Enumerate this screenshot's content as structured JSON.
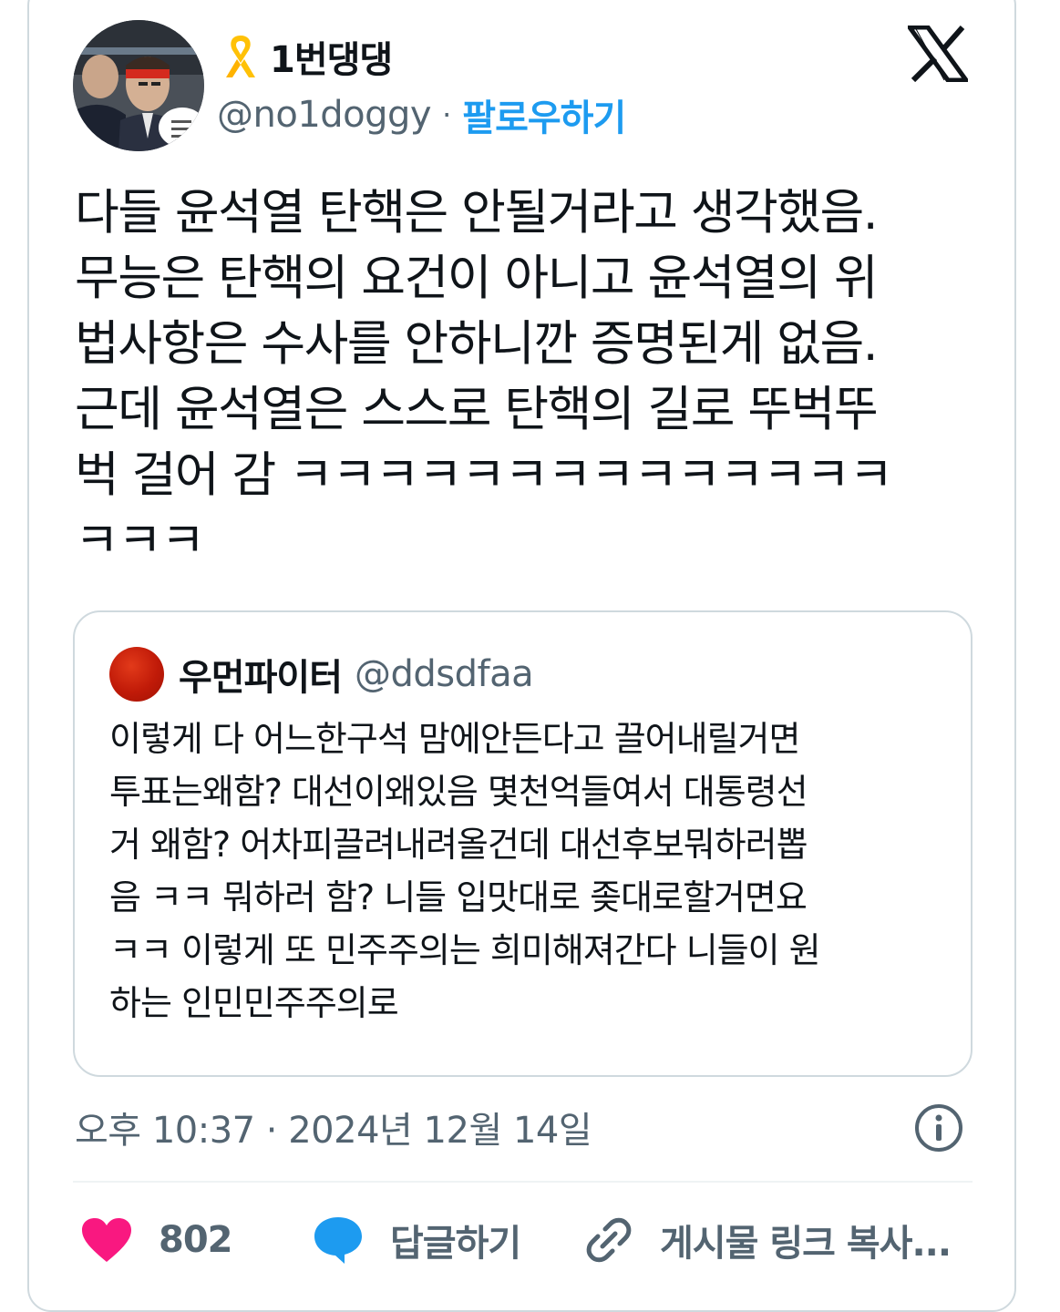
{
  "author": {
    "display_name": "1번댕댕",
    "handle": "@no1doggy",
    "separator": "·",
    "follow_label": "팔로우하기",
    "badge_icon": "yellow-ribbon-icon",
    "avatar_icon": "profile-photo"
  },
  "brand": {
    "logo_icon": "x-logo-icon"
  },
  "tweet": {
    "text": "다들 윤석열 탄핵은 안될거라고 생각했음.\n무능은 탄핵의 요건이 아니고 윤석열의 위\n법사항은 수사를 안하니깐 증명된게 없음.\n근데 윤석열은 스스로 탄핵의 길로 뚜벅뚜\n벅 걸어 감 ㅋㅋㅋㅋㅋㅋㅋㅋㅋㅋㅋㅋㅋㅋ\nㅋㅋㅋ"
  },
  "quote": {
    "display_name": "우먼파이터",
    "handle": "@ddsdfaa",
    "text": "이렇게 다 어느한구석 맘에안든다고 끌어내릴거면\n투표는왜함? 대선이왜있음 몇천억들여서 대통령선\n거 왜함? 어차피끌려내려올건데 대선후보뭐하러뽑\n음 ㅋㅋ 뭐하러 함? 니들 입맛대로 좆대로할거면요\nㅋㅋ 이렇게 또 민주주의는 희미해져간다 니들이 원\n하는 인민민주주의로"
  },
  "meta": {
    "timestamp": "오후 10:37 · 2024년 12월 14일",
    "info_icon": "info-icon"
  },
  "actions": {
    "like_count": "802",
    "reply_label": "답글하기",
    "copy_link_label": "게시물 링크 복사..."
  },
  "colors": {
    "accent": "#1d9bf0",
    "like": "#f91880",
    "secondary_text": "#536471",
    "border": "#cfd9de",
    "ribbon": "#ffc107"
  }
}
